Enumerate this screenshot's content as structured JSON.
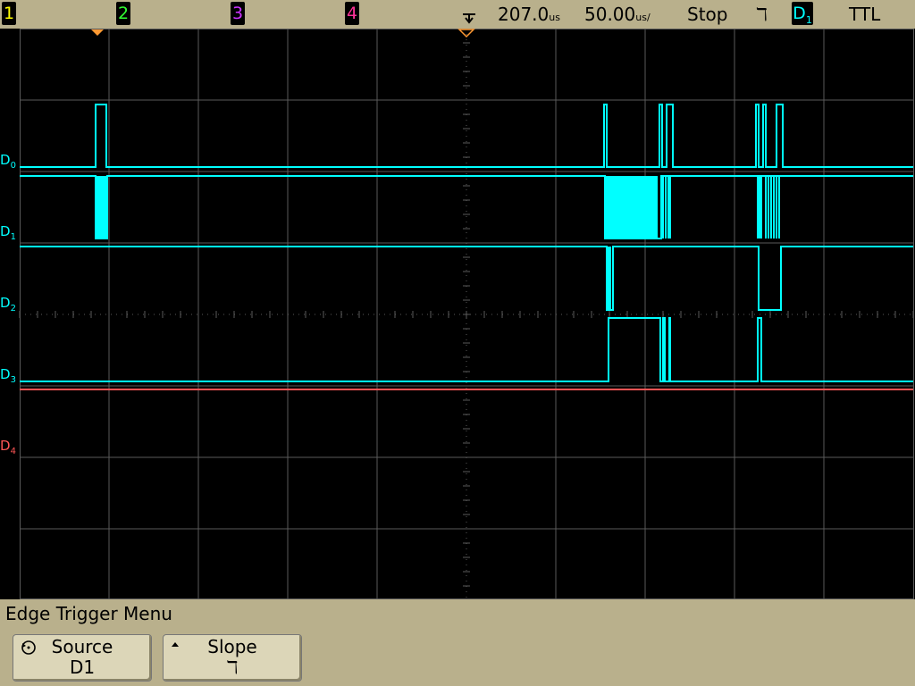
{
  "topbar": {
    "channels": [
      {
        "label": "1",
        "color": "#ffff00"
      },
      {
        "label": "2",
        "color": "#33ff33"
      },
      {
        "label": "3",
        "color": "#cc33ff"
      },
      {
        "label": "4",
        "color": "#ff3399"
      }
    ],
    "time_offset": "207.0",
    "time_offset_unit": "us",
    "time_per_div": "50.00",
    "time_per_div_unit": "us/",
    "run_state": "Stop",
    "trigger_slope_symbol": "ℸ",
    "trigger_source_letter": "D",
    "trigger_source_index": "1",
    "logic_threshold": "TTL"
  },
  "waveforms": {
    "labels": [
      {
        "letter": "D",
        "index": "0",
        "color": "#00ffff"
      },
      {
        "letter": "D",
        "index": "1",
        "color": "#00ffff"
      },
      {
        "letter": "D",
        "index": "2",
        "color": "#00ffff"
      },
      {
        "letter": "D",
        "index": "3",
        "color": "#00ffff"
      },
      {
        "letter": "D",
        "index": "4",
        "color": "#ff5555"
      }
    ],
    "trace_color": "#00ffff",
    "d4_color": "#ff5555",
    "grid_color": "#5a5a5a",
    "marker_color": "#ff9933"
  },
  "menu": {
    "title": "Edge Trigger Menu",
    "softkeys": [
      {
        "label": "Source",
        "value": "D1",
        "icon": "rotate-knob-icon"
      },
      {
        "label": "Slope",
        "value": "ℸ",
        "icon": "up-arrow-icon"
      }
    ]
  }
}
